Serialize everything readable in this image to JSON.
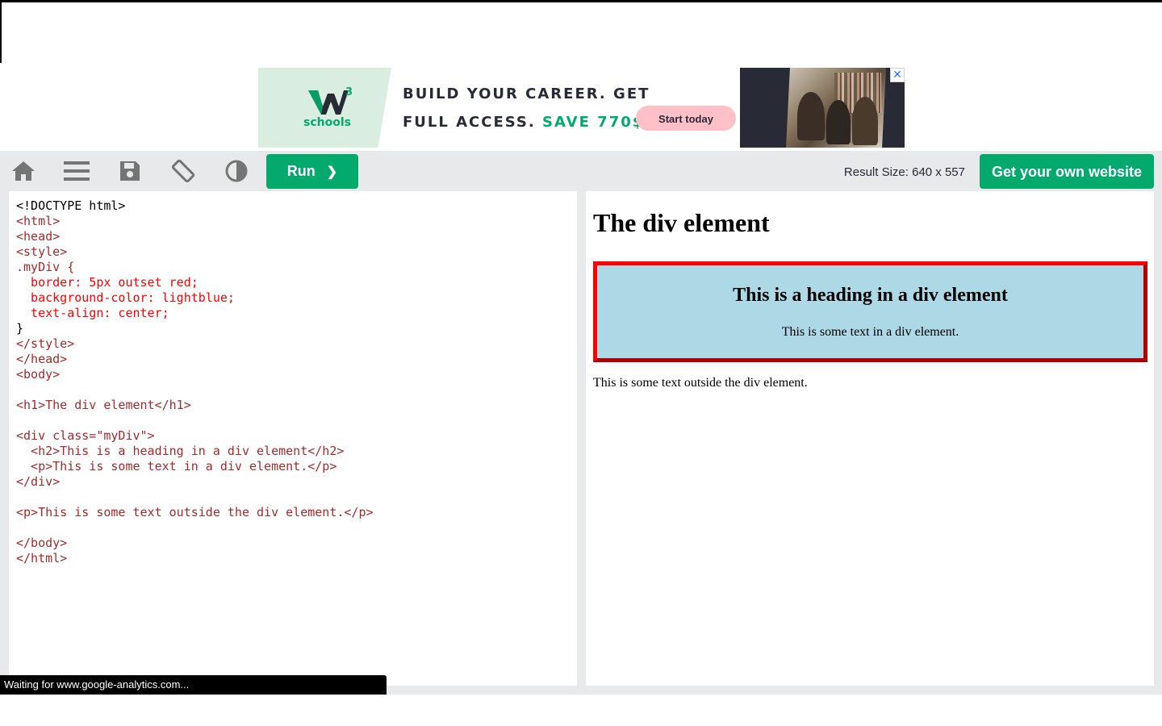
{
  "ad": {
    "logo_text": "schools",
    "logo_sup": "3",
    "line1": "BUILD YOUR CAREER. GET",
    "line2_prefix": "FULL ACCESS. ",
    "line2_highlight": "SAVE 770$",
    "cta_label": "Start today",
    "close_glyph": "✕",
    "colors": {
      "brand_green": "#04aa6d",
      "cta_pink": "#ffc0c7",
      "dark": "#282a35"
    }
  },
  "toolbar": {
    "icons": [
      "home-icon",
      "menu-icon",
      "save-icon",
      "rotate-icon",
      "contrast-icon"
    ],
    "run_label": "Run",
    "run_chevron": "❯",
    "result_size": "Result Size: 640 x 557",
    "get_website_label": "Get your own website"
  },
  "code": {
    "lines": [
      "<!DOCTYPE html>",
      "<html>",
      "<head>",
      "<style>",
      ".myDiv {",
      "  border: 5px outset red;",
      "  background-color: lightblue;",
      "  text-align: center;",
      "}",
      "</style>",
      "</head>",
      "<body>",
      "",
      "<h1>The div element</h1>",
      "",
      "<div class=\"myDiv\">",
      "  <h2>This is a heading in a div element</h2>",
      "  <p>This is some text in a div element.</p>",
      "</div>",
      "",
      "<p>This is some text outside the div element.</p>",
      "",
      "</body>",
      "</html>"
    ]
  },
  "result": {
    "h1": "The div element",
    "div_h2": "This is a heading in a div element",
    "div_p": "This is some text in a div element.",
    "outer_p": "This is some text outside the div element."
  },
  "status": {
    "text": "Waiting for www.google-analytics.com..."
  }
}
